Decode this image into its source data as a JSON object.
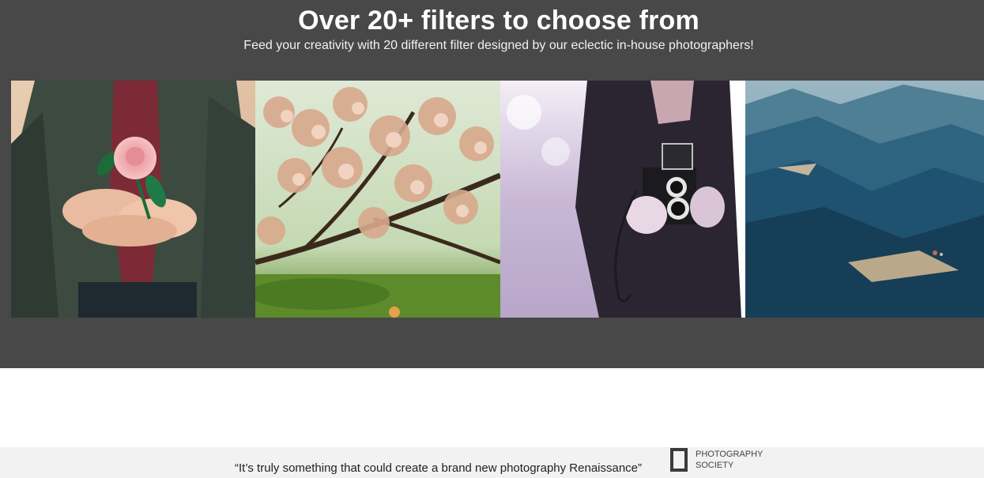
{
  "filters": {
    "title": "Over 20+ filters to choose from",
    "subtitle": "Feed your creativity with 20 different filter designed by our eclectic in-house photographers!",
    "background_color": "#484848"
  },
  "gallery": {
    "photos": [
      {
        "icon": "photo-rose-in-hands",
        "dominant_color": "#3e4a3f"
      },
      {
        "icon": "photo-blossom-tree",
        "dominant_color": "#c9b08a"
      },
      {
        "icon": "photo-man-with-camera",
        "dominant_color": "#2a2030"
      },
      {
        "icon": "photo-mountain-valley",
        "dominant_color": "#24506a"
      }
    ]
  },
  "testimonial": {
    "quote": "“It’s truly something that could create a brand new photography Renaissance”",
    "source_line1": "PHOTOGRAPHY",
    "source_line2": "SOCIETY",
    "background_color": "#f2f2f2"
  }
}
